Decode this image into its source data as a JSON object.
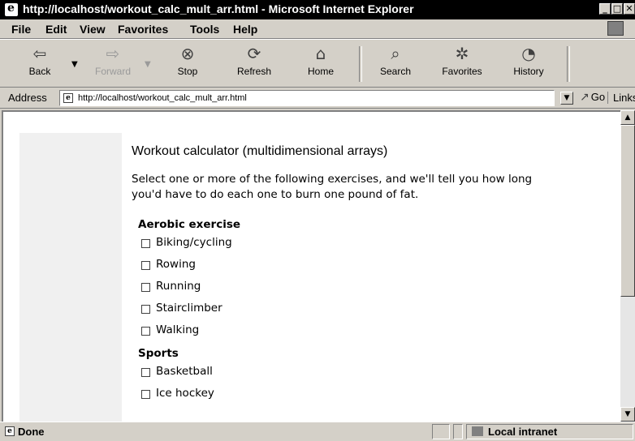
{
  "window": {
    "title": "http://localhost/workout_calc_mult_arr.html - Microsoft Internet Explorer",
    "minimize_glyph": "_",
    "maximize_glyph": "□",
    "close_glyph": "✕"
  },
  "menu": {
    "items": [
      {
        "label": "File"
      },
      {
        "label": "Edit"
      },
      {
        "label": "View"
      },
      {
        "label": "Favorites"
      },
      {
        "label": "Tools"
      },
      {
        "label": "Help"
      }
    ]
  },
  "toolbar": {
    "buttons": [
      {
        "label": "Back",
        "icon": "back-arrow-icon",
        "enabled": true
      },
      {
        "label": "Forward",
        "icon": "forward-arrow-icon",
        "enabled": false
      },
      {
        "label": "Stop",
        "icon": "stop-icon",
        "enabled": true
      },
      {
        "label": "Refresh",
        "icon": "refresh-icon",
        "enabled": true
      },
      {
        "label": "Home",
        "icon": "home-icon",
        "enabled": true
      },
      {
        "label": "Search",
        "icon": "search-icon",
        "enabled": true
      },
      {
        "label": "Favorites",
        "icon": "favorites-icon",
        "enabled": true
      },
      {
        "label": "History",
        "icon": "history-icon",
        "enabled": true
      }
    ]
  },
  "address_bar": {
    "label": "Address",
    "url": "http://localhost/workout_calc_mult_arr.html",
    "go_label": "Go",
    "links_label": "Links"
  },
  "page": {
    "title": "Workout calculator (multidimensional arrays)",
    "intro": "Select one or more of the following exercises, and we'll tell you how long you'd have to do each one to burn one pound of fat.",
    "sections": [
      {
        "heading": "Aerobic exercise",
        "items": [
          {
            "label": "Biking/cycling",
            "checked": false
          },
          {
            "label": "Rowing",
            "checked": false
          },
          {
            "label": "Running",
            "checked": false
          },
          {
            "label": "Stairclimber",
            "checked": false
          },
          {
            "label": "Walking",
            "checked": false
          }
        ]
      },
      {
        "heading": "Sports",
        "items": [
          {
            "label": "Basketball",
            "checked": false
          },
          {
            "label": "Ice hockey",
            "checked": false
          }
        ]
      }
    ]
  },
  "status_bar": {
    "status": "Done",
    "zone": "Local intranet"
  },
  "colors": {
    "chrome": "#d4d0c8",
    "titlebar": "#000000",
    "page_background": "#ffffff",
    "sidebar_strip": "#f0f0f0"
  }
}
